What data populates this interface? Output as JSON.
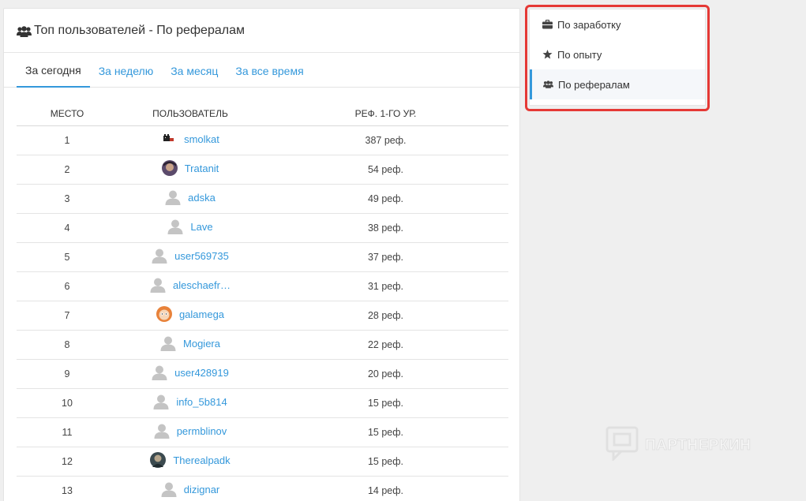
{
  "card": {
    "title": "Топ пользователей - По рефералам"
  },
  "tabs": [
    {
      "label": "За сегодня",
      "active": true
    },
    {
      "label": "За неделю",
      "active": false
    },
    {
      "label": "За месяц",
      "active": false
    },
    {
      "label": "За все время",
      "active": false
    }
  ],
  "table": {
    "headers": {
      "place": "МЕСТО",
      "user": "ПОЛЬЗОВАТЕЛЬ",
      "refs": "РЕФ. 1-ГО УР."
    },
    "rows": [
      {
        "place": "1",
        "user": "smolkat",
        "refs": "387 реф.",
        "avatar": "pixel-icon"
      },
      {
        "place": "2",
        "user": "Tratanit",
        "refs": "54 реф.",
        "avatar": "photo-avatar"
      },
      {
        "place": "3",
        "user": "adska",
        "refs": "49 реф.",
        "avatar": "default-user-icon"
      },
      {
        "place": "4",
        "user": "Lave",
        "refs": "38 реф.",
        "avatar": "default-user-icon"
      },
      {
        "place": "5",
        "user": "user569735",
        "refs": "37 реф.",
        "avatar": "default-user-icon"
      },
      {
        "place": "6",
        "user": "aleschaefr…",
        "refs": "31 реф.",
        "avatar": "default-user-icon"
      },
      {
        "place": "7",
        "user": "galamega",
        "refs": "28 реф.",
        "avatar": "cartoon-avatar"
      },
      {
        "place": "8",
        "user": "Mogiera",
        "refs": "22 реф.",
        "avatar": "default-user-icon"
      },
      {
        "place": "9",
        "user": "user428919",
        "refs": "20 реф.",
        "avatar": "default-user-icon"
      },
      {
        "place": "10",
        "user": "info_5b814",
        "refs": "15 реф.",
        "avatar": "default-user-icon"
      },
      {
        "place": "11",
        "user": "permblinov",
        "refs": "15 реф.",
        "avatar": "default-user-icon"
      },
      {
        "place": "12",
        "user": "Therealpadk",
        "refs": "15 реф.",
        "avatar": "photo-avatar-dark"
      },
      {
        "place": "13",
        "user": "dizignar",
        "refs": "14 реф.",
        "avatar": "default-user-icon"
      }
    ]
  },
  "sidebar": {
    "highlight_color": "#e53935",
    "items": [
      {
        "label": "По заработку",
        "icon": "briefcase-icon",
        "active": false
      },
      {
        "label": "По опыту",
        "icon": "star-icon",
        "active": false
      },
      {
        "label": "По рефералам",
        "icon": "users-icon",
        "active": true
      }
    ]
  },
  "watermark": {
    "text": "ПАРТНЕРКИН"
  },
  "colors": {
    "accent": "#3498db",
    "background": "#efefef",
    "highlight": "#e53935"
  }
}
